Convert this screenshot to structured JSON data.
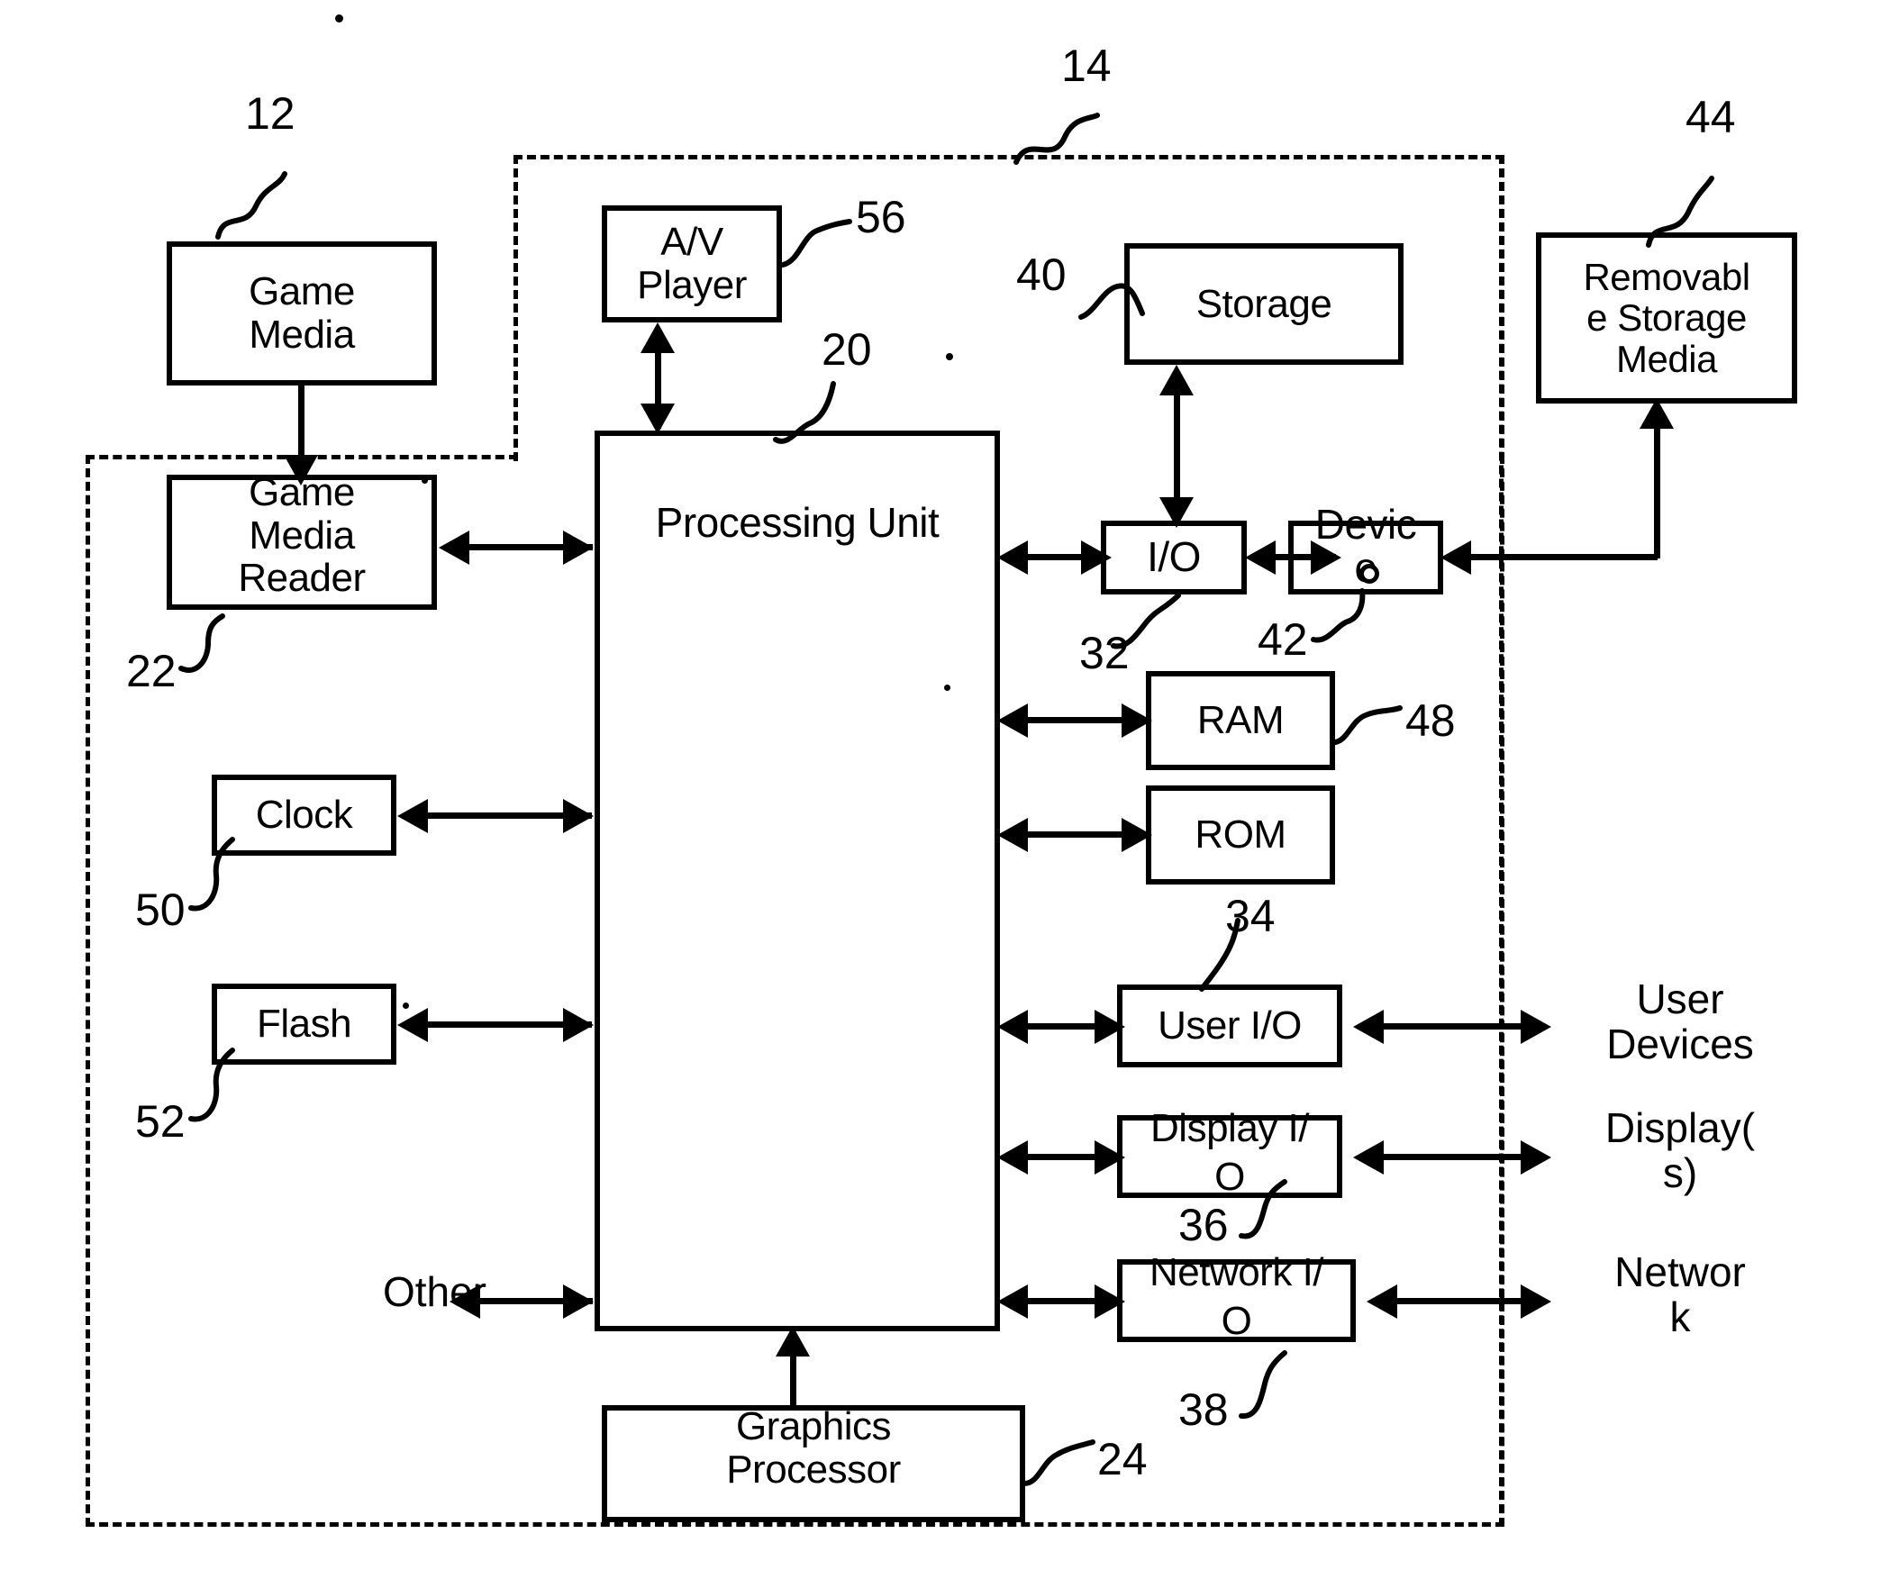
{
  "figure": {
    "type": "patent-block-diagram",
    "description": "Game system hardware block diagram"
  },
  "blocks": {
    "game_media": "Game\nMedia",
    "game_media_reader": "Game\nMedia\nReader",
    "av_player": "A/V\nPlayer",
    "processing_unit": "Processing Unit",
    "storage": "Storage",
    "removable_storage_media": "Removabl\ne Storage\nMedia",
    "io": "I/O",
    "device": "Devic\ne",
    "ram": "RAM",
    "rom": "ROM",
    "user_io": "User I/O",
    "display_io": "Display I/\nO",
    "network_io": "Network I/\nO",
    "clock": "Clock",
    "flash": "Flash",
    "graphics_processor": "Graphics\nProcessor"
  },
  "free_labels": {
    "other": "Other",
    "user_devices": "User\nDevices",
    "displays": "Display(\ns)",
    "network": "Networ\nk"
  },
  "reference_numerals": {
    "n12": "12",
    "n14": "14",
    "n20": "20",
    "n22": "22",
    "n24": "24",
    "n32": "32",
    "n34": "34",
    "n36": "36",
    "n38": "38",
    "n40": "40",
    "n42": "42",
    "n44": "44",
    "n48": "48",
    "n50": "50",
    "n52": "52",
    "n56": "56"
  },
  "colors": {
    "ink": "#000000",
    "paper": "#ffffff"
  }
}
